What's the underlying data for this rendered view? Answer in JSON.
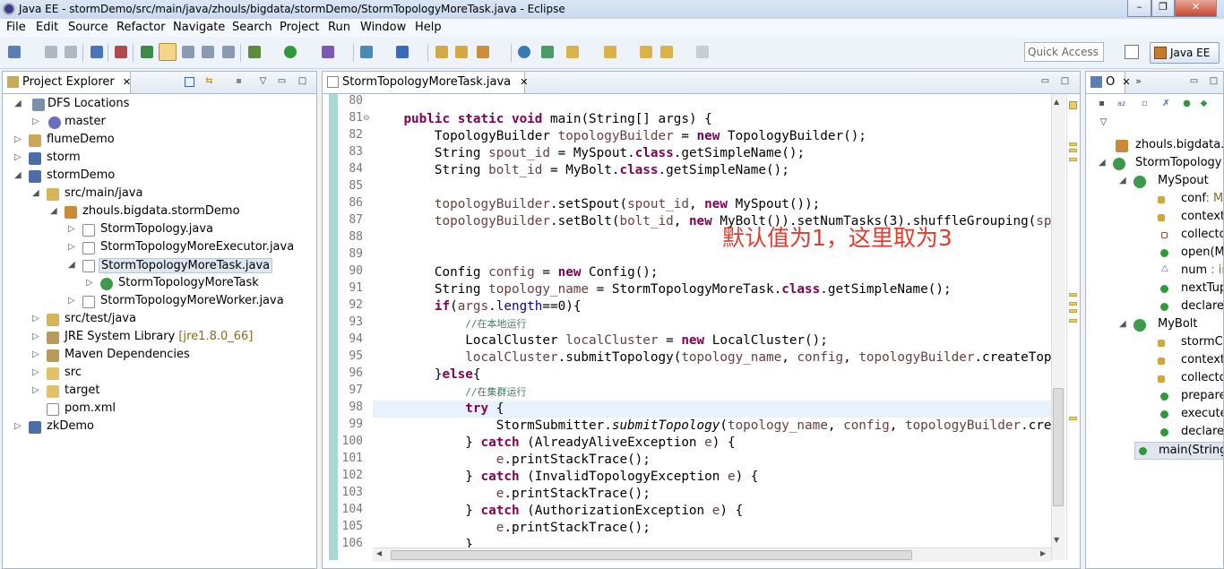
{
  "window": {
    "title": "Java EE - stormDemo/src/main/java/zhouls/bigdata/stormDemo/StormTopologyMoreTask.java - Eclipse",
    "minimize": "–",
    "maximize": "❐",
    "close": "✕"
  },
  "menu": [
    "File",
    "Edit",
    "Source",
    "Refactor",
    "Navigate",
    "Search",
    "Project",
    "Run",
    "Window",
    "Help"
  ],
  "toolbar": {
    "quick_access_placeholder": "Quick Access",
    "perspective": "Java EE"
  },
  "project_explorer": {
    "title": "Project Explorer",
    "close": "✕",
    "rows": [
      {
        "label": "DFS Locations",
        "decoration": ""
      },
      {
        "label": "master",
        "decoration": ""
      },
      {
        "label": "flumeDemo",
        "decoration": ""
      },
      {
        "label": "storm",
        "decoration": ""
      },
      {
        "label": "stormDemo",
        "decoration": ""
      },
      {
        "label": "src/main/java",
        "decoration": ""
      },
      {
        "label": "zhouls.bigdata.stormDemo",
        "decoration": ""
      },
      {
        "label": "StormTopology.java",
        "decoration": ""
      },
      {
        "label": "StormTopologyMoreExecutor.java",
        "decoration": ""
      },
      {
        "label": "StormTopologyMoreTask.java",
        "decoration": ""
      },
      {
        "label": "StormTopologyMoreTask",
        "decoration": ""
      },
      {
        "label": "StormTopologyMoreWorker.java",
        "decoration": ""
      },
      {
        "label": "src/test/java",
        "decoration": ""
      },
      {
        "label": "JRE System Library",
        "decoration": "[jre1.8.0_66]"
      },
      {
        "label": "Maven Dependencies",
        "decoration": ""
      },
      {
        "label": "src",
        "decoration": ""
      },
      {
        "label": "target",
        "decoration": ""
      },
      {
        "label": "pom.xml",
        "decoration": ""
      },
      {
        "label": "zkDemo",
        "decoration": ""
      }
    ]
  },
  "editor": {
    "tab": "StormTopologyMoreTask.java",
    "close": "✕",
    "line_numbers": [
      "80",
      "81",
      "82",
      "83",
      "84",
      "85",
      "86",
      "87",
      "88",
      "89",
      "90",
      "91",
      "92",
      "93",
      "94",
      "95",
      "96",
      "97",
      "98",
      "99",
      "100",
      "101",
      "102",
      "103",
      "104",
      "105",
      "106"
    ],
    "annotation": "默认值为1，这里取为3",
    "comment_local": "//在本地运行",
    "comment_cluster": "//在集群运行"
  },
  "outline": {
    "title": "O",
    "rows": [
      {
        "label": "zhouls.bigdata.s"
      },
      {
        "label": "StormTopology"
      },
      {
        "label": "MySpout"
      },
      {
        "label": "conf",
        "decoration": ": M"
      },
      {
        "label": "context"
      },
      {
        "label": "collecto"
      },
      {
        "label": "open(M"
      },
      {
        "label": "num",
        "decoration": ": ir"
      },
      {
        "label": "nextTup"
      },
      {
        "label": "declare"
      },
      {
        "label": "MyBolt"
      },
      {
        "label": "stormC"
      },
      {
        "label": "context"
      },
      {
        "label": "collecto"
      },
      {
        "label": "prepare"
      },
      {
        "label": "execute"
      },
      {
        "label": "declare"
      },
      {
        "label": "main(String"
      }
    ]
  },
  "colors": {
    "keyword": "#7f0055",
    "field": "#0000c0",
    "comment": "#3f7f5f",
    "annotation": "#e53a2e"
  }
}
